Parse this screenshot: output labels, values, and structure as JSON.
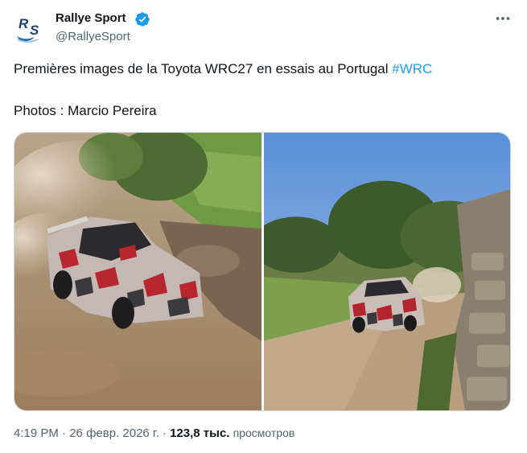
{
  "author": {
    "display_name": "Rallye Sport",
    "handle": "@RallyeSport",
    "avatar_text": "RS",
    "avatar_icon": "rallye-sport-logo",
    "verified_icon": "verified-badge-icon"
  },
  "post": {
    "text": "Premières images de la Toyota WRC27 en essais au Portugal",
    "hashtag": "#WRC",
    "credit": "Photos : Marcio Pereira",
    "timestamp": "4:19 PM",
    "separator": "·",
    "date": "26 февр. 2026 г.",
    "views_count": "123,8 тыс.",
    "views_label": "просмотров"
  },
  "media": {
    "count": 2,
    "photos": [
      {
        "subject": "camouflaged-rally-car-dusty-gravel-turn"
      },
      {
        "subject": "camouflaged-rally-car-gravel-road-stone-wall"
      }
    ]
  },
  "colors": {
    "text": "#0f1419",
    "secondary": "#536471",
    "link": "#1d9bf0",
    "border": "#cfd9de"
  },
  "menu": {
    "more_icon": "more-horizontal-icon"
  }
}
